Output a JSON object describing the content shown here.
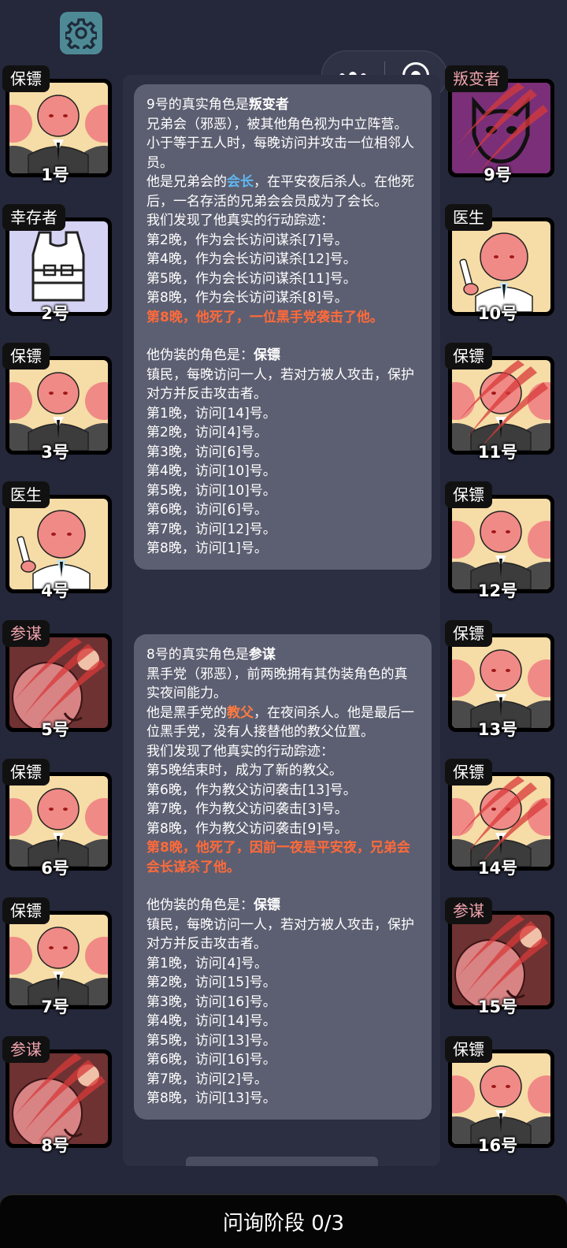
{
  "header": {
    "settings_icon": "gear-icon",
    "capsule_more_icon": "more-dots-icon",
    "capsule_close_icon": "record-circle-icon"
  },
  "left_column": [
    {
      "role": "保镖",
      "number": "1号",
      "portrait": "bodyguard",
      "evil": false,
      "dead": false
    },
    {
      "role": "幸存者",
      "number": "2号",
      "portrait": "vest",
      "evil": false,
      "dead": false
    },
    {
      "role": "保镖",
      "number": "3号",
      "portrait": "bodyguard",
      "evil": false,
      "dead": false
    },
    {
      "role": "医生",
      "number": "4号",
      "portrait": "doctor",
      "evil": false,
      "dead": false
    },
    {
      "role": "参谋",
      "number": "5号",
      "portrait": "advisor",
      "evil": true,
      "dead": true
    },
    {
      "role": "保镖",
      "number": "6号",
      "portrait": "bodyguard",
      "evil": false,
      "dead": false
    },
    {
      "role": "保镖",
      "number": "7号",
      "portrait": "bodyguard",
      "evil": false,
      "dead": false
    },
    {
      "role": "参谋",
      "number": "8号",
      "portrait": "advisor",
      "evil": true,
      "dead": true
    }
  ],
  "right_column": [
    {
      "role": "叛变者",
      "number": "9号",
      "portrait": "traitor",
      "evil": true,
      "dead": true
    },
    {
      "role": "医生",
      "number": "10号",
      "portrait": "doctor",
      "evil": false,
      "dead": false
    },
    {
      "role": "保镖",
      "number": "11号",
      "portrait": "bodyguard",
      "evil": false,
      "dead": true
    },
    {
      "role": "保镖",
      "number": "12号",
      "portrait": "bodyguard",
      "evil": false,
      "dead": false
    },
    {
      "role": "保镖",
      "number": "13号",
      "portrait": "bodyguard",
      "evil": false,
      "dead": false
    },
    {
      "role": "保镖",
      "number": "14号",
      "portrait": "bodyguard",
      "evil": false,
      "dead": true
    },
    {
      "role": "参谋",
      "number": "15号",
      "portrait": "advisor",
      "evil": true,
      "dead": true
    },
    {
      "role": "保镖",
      "number": "16号",
      "portrait": "bodyguard",
      "evil": false,
      "dead": false
    }
  ],
  "panel1": {
    "title_prefix": "9号的真实角色是",
    "title_role": "叛变者",
    "desc": "兄弟会（邪恶），被其他角色视为中立阵营。小于等于五人时，每晚访问并攻击一位相邻人员。",
    "rank_prefix": "他是兄弟会的",
    "rank": "会长",
    "rank_suffix": "，在平安夜后杀人。在他死后，一名存活的兄弟会会员成为了会长。",
    "track_title": "我们发现了他真实的行动踪迹：",
    "tracks": [
      "第2晚，作为会长访问谋杀[7]号。",
      "第4晚，作为会长访问谋杀[12]号。",
      "第5晚，作为会长访问谋杀[11]号。",
      "第8晚，作为会长访问谋杀[8]号。"
    ],
    "death": "第8晚，他死了，一位黑手党袭击了他。",
    "disguise_prefix": "他伪装的角色是：",
    "disguise_role": "保镖",
    "disguise_desc": "镇民，每晚访问一人，若对方被人攻击，保护对方并反击攻击者。",
    "visits": [
      "第1晚，访问[14]号。",
      "第2晚，访问[4]号。",
      "第3晚，访问[6]号。",
      "第4晚，访问[10]号。",
      "第5晚，访问[10]号。",
      "第6晚，访问[6]号。",
      "第7晚，访问[12]号。",
      "第8晚，访问[1]号。"
    ]
  },
  "panel2": {
    "title_prefix": "8号的真实角色是",
    "title_role": "参谋",
    "desc": "黑手党（邪恶），前两晚拥有其伪装角色的真实夜间能力。",
    "rank_prefix": "他是黑手党的",
    "rank": "教父",
    "rank_suffix": "，在夜间杀人。他是最后一位黑手党，没有人接替他的教父位置。",
    "track_title": "我们发现了他真实的行动踪迹：",
    "tracks": [
      "第5晚结束时，成为了新的教父。",
      "第6晚，作为教父访问袭击[13]号。",
      "第7晚，作为教父访问袭击[3]号。",
      "第8晚，作为教父访问袭击[9]号。"
    ],
    "death": "第8晚，他死了，因前一夜是平安夜，兄弟会会长谋杀了他。",
    "disguise_prefix": "他伪装的角色是：",
    "disguise_role": "保镖",
    "disguise_desc": "镇民，每晚访问一人，若对方被人攻击，保护对方并反击攻击者。",
    "visits": [
      "第1晚，访问[4]号。",
      "第2晚，访问[15]号。",
      "第3晚，访问[16]号。",
      "第4晚，访问[14]号。",
      "第5晚，访问[13]号。",
      "第6晚，访问[16]号。",
      "第7晚，访问[2]号。",
      "第8晚，访问[13]号。"
    ]
  },
  "footer": {
    "phase_label": "问询阶段 0/3"
  },
  "colors": {
    "background": "#25273a",
    "panel": "#5c5f71",
    "highlight_blue": "#5fb6f0",
    "highlight_red": "#ff6a3a",
    "evil_tag": "#f0a3ad"
  }
}
